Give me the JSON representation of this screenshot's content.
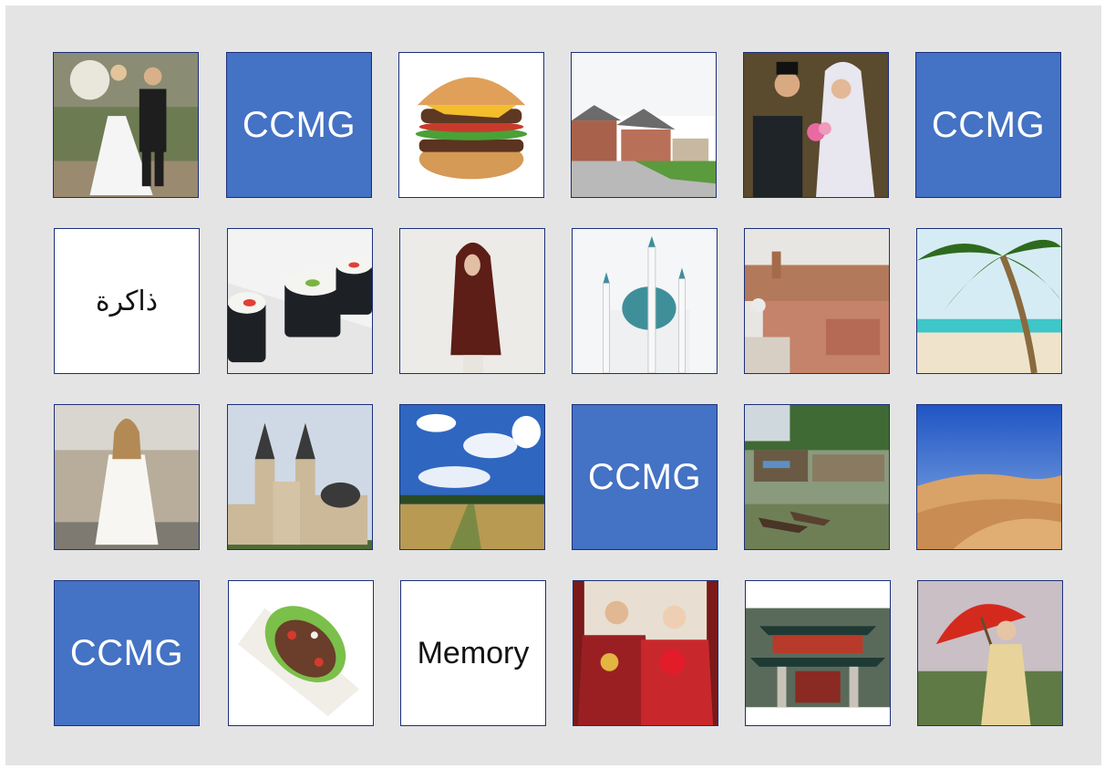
{
  "game": {
    "cover_label": "CCMG",
    "words": {
      "arabic": "ذاكرة",
      "english": "Memory"
    }
  },
  "cards": [
    {
      "kind": "image",
      "subject": "wedding couple in garden"
    },
    {
      "kind": "cover",
      "label": "CCMG"
    },
    {
      "kind": "image",
      "subject": "hamburger"
    },
    {
      "kind": "image",
      "subject": "suburban houses"
    },
    {
      "kind": "image",
      "subject": "wedding couple in hijab"
    },
    {
      "kind": "cover",
      "label": "CCMG"
    },
    {
      "kind": "word",
      "label": "ذاكرة"
    },
    {
      "kind": "image",
      "subject": "sushi rolls"
    },
    {
      "kind": "image",
      "subject": "woman in hijab"
    },
    {
      "kind": "image",
      "subject": "mosque"
    },
    {
      "kind": "image",
      "subject": "old city rooftops"
    },
    {
      "kind": "image",
      "subject": "palm beach"
    },
    {
      "kind": "image",
      "subject": "woman in white dress"
    },
    {
      "kind": "image",
      "subject": "cathedral"
    },
    {
      "kind": "image",
      "subject": "wheat field and sky"
    },
    {
      "kind": "cover",
      "label": "CCMG"
    },
    {
      "kind": "image",
      "subject": "stilt village with boats"
    },
    {
      "kind": "image",
      "subject": "desert dunes"
    },
    {
      "kind": "cover",
      "label": "CCMG"
    },
    {
      "kind": "image",
      "subject": "wrap sandwich"
    },
    {
      "kind": "word",
      "label": "Memory"
    },
    {
      "kind": "image",
      "subject": "chinese wedding couple"
    },
    {
      "kind": "image",
      "subject": "japanese gate building"
    },
    {
      "kind": "image",
      "subject": "woman with red parasol"
    }
  ],
  "colors": {
    "cover_blue": "#4472c4",
    "card_border": "#1c2f7a",
    "board_gray": "#e4e4e4"
  }
}
